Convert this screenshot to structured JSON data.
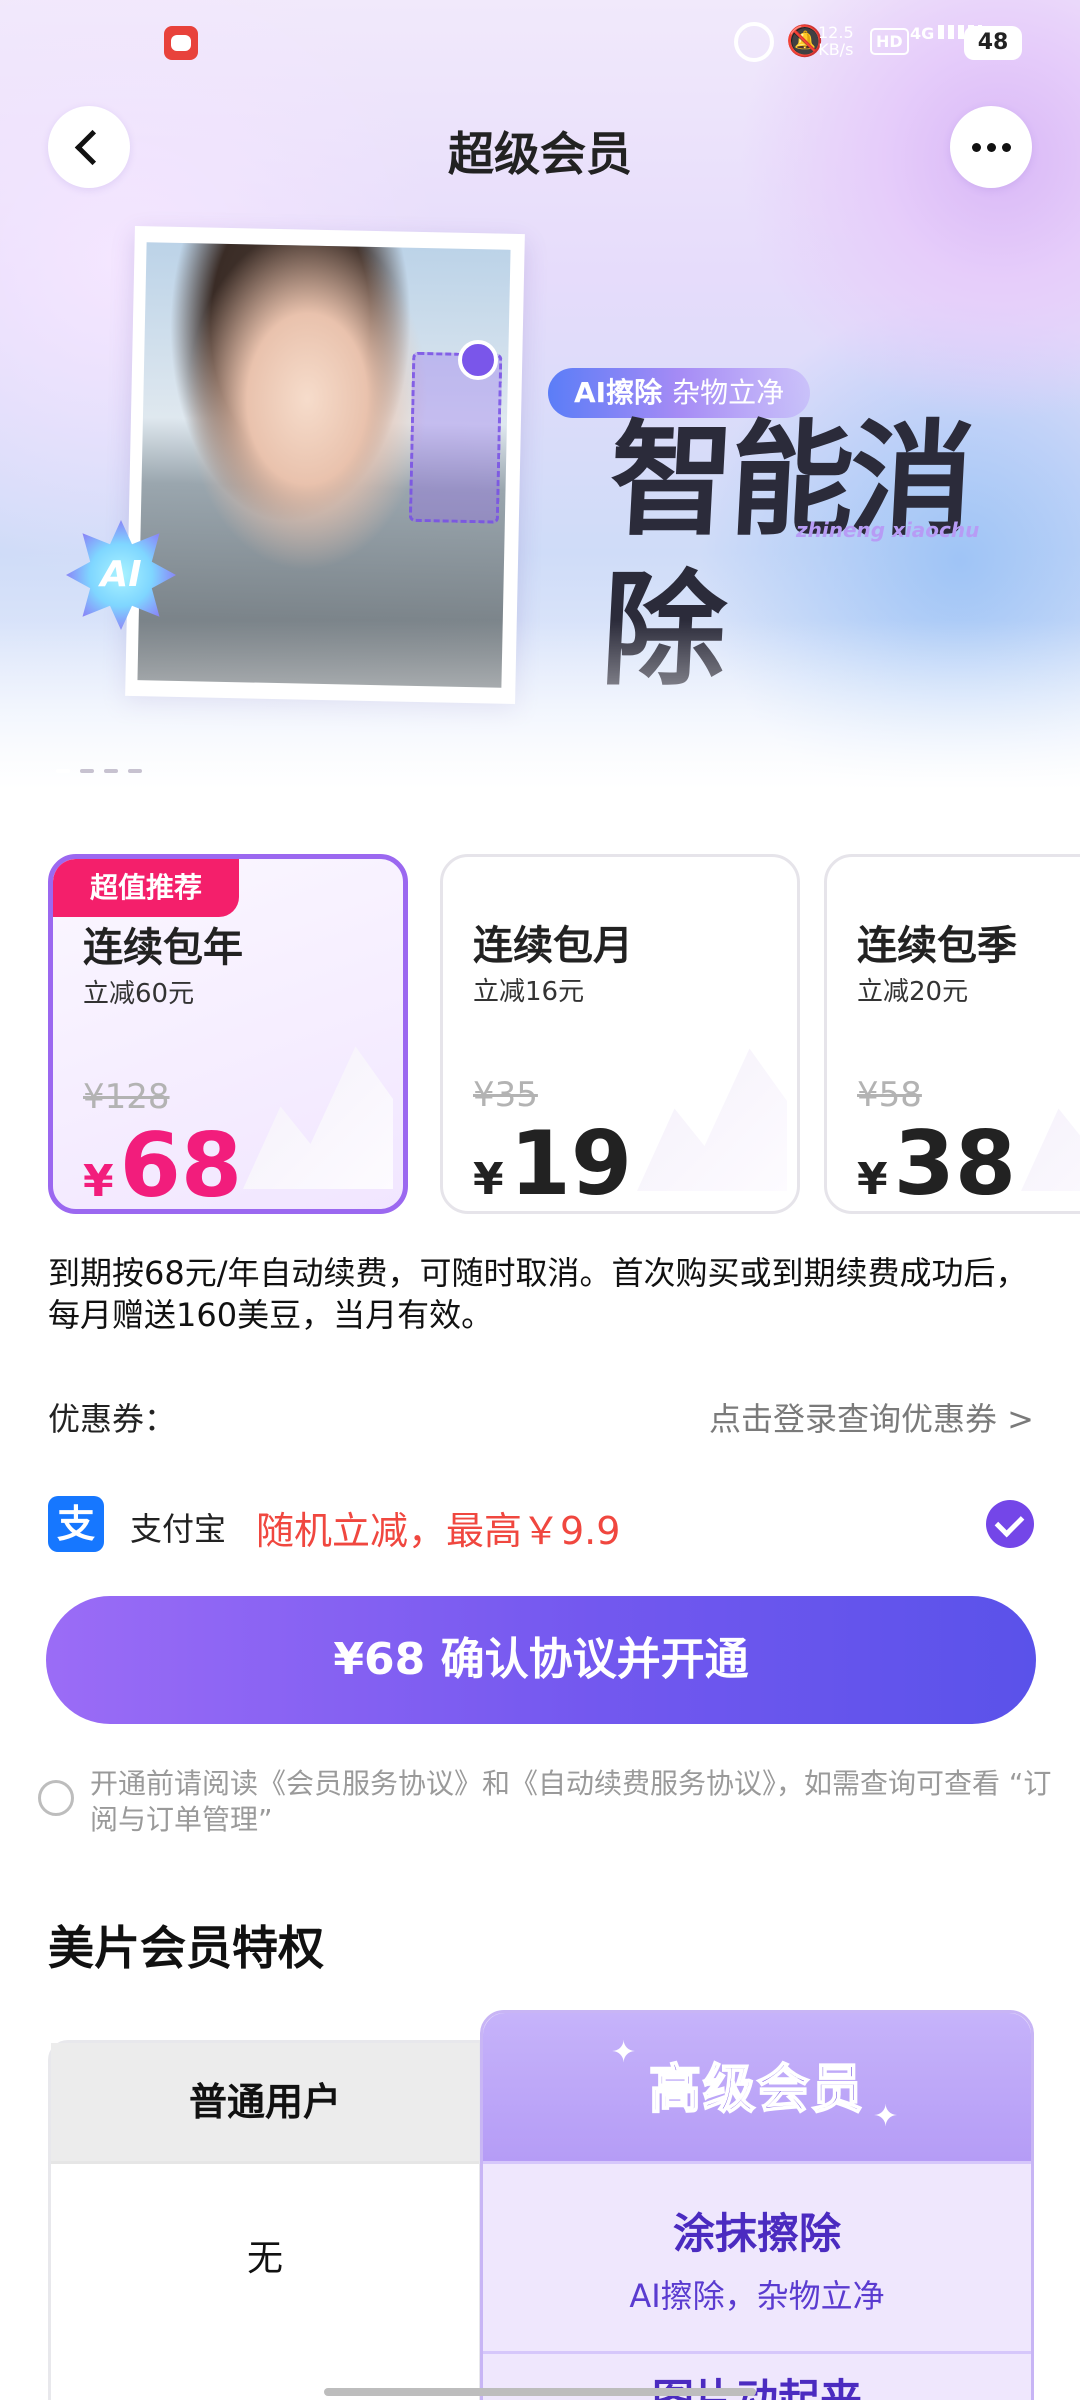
{
  "status_bar": {
    "net_speed": "12.5\nKB/s",
    "hd": "HD",
    "network": "4G",
    "battery": "48"
  },
  "header": {
    "title": "超级会员"
  },
  "banner": {
    "pill_bold": "AI擦除",
    "pill_text": "杂物立净",
    "headline": "智能消除",
    "pinyin": "zhineng xiaochu",
    "badge": "AI"
  },
  "plans": [
    {
      "tag": "超值推荐",
      "name": "连续包年",
      "discount": "立减60元",
      "original": "¥128",
      "currency": "¥",
      "price": "68",
      "selected": true
    },
    {
      "name": "连续包月",
      "discount": "立减16元",
      "original": "¥35",
      "currency": "¥",
      "price": "19",
      "selected": false
    },
    {
      "name": "连续包季",
      "discount": "立减20元",
      "original": "¥58",
      "currency": "¥",
      "price": "38",
      "selected": false
    }
  ],
  "renewal_desc": "到期按68元/年自动续费，可随时取消。首次购买或到期续费成功后，每月赠送160美豆，当月有效。",
  "coupon": {
    "label": "优惠券：",
    "action": "点击登录查询优惠券 >"
  },
  "payment": {
    "logo": "支",
    "name": "支付宝",
    "promo": "随机立减，最高￥9.9",
    "checked": true
  },
  "cta": {
    "label": "¥68 确认协议并开通"
  },
  "agreement": {
    "text": "开通前请阅读《会员服务协议》和《自动续费服务协议》，如需查询可查看 “订阅与订单管理”",
    "checked": false
  },
  "privileges": {
    "title": "美片会员特权",
    "col_basic": "普通用户",
    "col_premium": "高级会员",
    "rows": [
      {
        "basic": "无",
        "premium_title": "涂抹擦除",
        "premium_sub": "AI擦除，杂物立净"
      },
      {
        "premium_title": "图片动起来"
      }
    ]
  },
  "colors": {
    "accent": "#7446e8",
    "price_pink": "#f21d7c",
    "tag_red": "#f41f6b",
    "promo_red": "#f0473f"
  }
}
